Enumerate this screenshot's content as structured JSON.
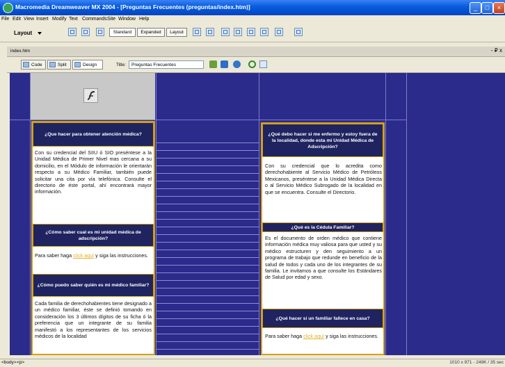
{
  "window": {
    "title": "Macromedia Dreamweaver MX 2004 - [Preguntas Frecuentes (preguntas/index.htm)]",
    "minimize_glyph": "_",
    "maximize_glyph": "□",
    "close_glyph": "×"
  },
  "menu": [
    "File",
    "Edit",
    "View",
    "Insert",
    "Modify",
    "Text",
    "Commands",
    "Site",
    "Window",
    "Help"
  ],
  "insert_bar": {
    "category": "Layout",
    "modes": [
      "Standard",
      "Expanded",
      "Layout"
    ]
  },
  "document": {
    "tab": "index.htm",
    "window_controls": "- ₽ x",
    "views": [
      "Code",
      "Split",
      "Design"
    ],
    "title_label": "Title:",
    "title_value": "Preguntas Frecuentes"
  },
  "content": {
    "left": [
      {
        "heading": "¿Que hacer para obtener atención médica?",
        "text": "Con su credencial del SIIU ó SIO preséntese a la Unidad Médica de Primer Nivel mas cercana a su domicilio, en el Módulo de información le orientarán respecto a su Médico Familiar, también puede solicitar una cita por vía telefónica. Consulte el directorio de éste portal, ahí encontrará mayor información."
      },
      {
        "heading": "¿Cómo saber cual es mi unidad médica de adscripción?",
        "text_pre": "Para saber haga ",
        "link": "click aquí",
        "text_post": " y siga las instrucciones."
      },
      {
        "heading": "¿Cómo puedo saber quién es mi médico familiar?",
        "text": "Cada familia de derechohabientes tiene designado a un médico familiar, éste se definió tomando en consideración los 3 últimos dígitos de su ficha ó la preferencia que un integrante de su familia manifestó a los representantes de los servicios médicos de la localidad"
      }
    ],
    "right": [
      {
        "heading": "¿Qué debo hacer si me enfermo y estoy fuera de la localidad, donde esta mi Unidad Médica de Adscripción?",
        "text": "Con su credencial que lo acredita como derechohabiente al Servicio Médico de Petróleos Mexicanos, preséntese a la Unidad Médica Directa o al Servicio Médico Subrogado de la localidad en que se encuentra. Consulte el Directorio."
      },
      {
        "heading": "¿Qué es la Cédula Familiar?",
        "text": "Es el documento de orden médico que contiene información médica muy valiosa para que usted y su médico estructuren y den seguimiento a un programa de trabajo que redunde en beneficio de la salud de todos y cada uno de los integrantes de su familia. Le invitamos a que consulte los Estándares de Salud por edad y sexo."
      },
      {
        "heading": "¿Qué hacer si un familiar fallece en casa?",
        "text_pre": "Para saber haga ",
        "link": "click aquí",
        "text_post": " y siga las instrucciones."
      }
    ]
  },
  "status": {
    "tags": [
      "<body>",
      "<p>"
    ],
    "info": "1010 x 971 - 249K / 35 sec"
  },
  "colors": {
    "page_bg": "#2b2b8c",
    "box_border": "#d4a017",
    "heading_bg": "#1f2460",
    "link": "#e0b020"
  }
}
